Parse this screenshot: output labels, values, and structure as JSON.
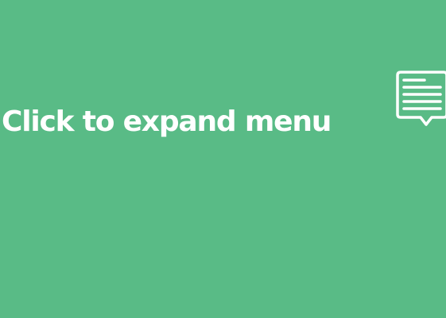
{
  "toggle": {
    "label": "Click to expand menu"
  },
  "icon": {
    "name": "chat-message-icon"
  },
  "colors": {
    "background": "#59bb86",
    "foreground": "#ffffff"
  }
}
